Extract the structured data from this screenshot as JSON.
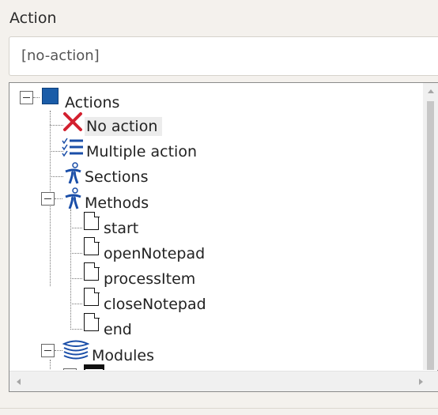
{
  "header": {
    "label": "Action",
    "field_value": "[no-action]"
  },
  "tree": {
    "root": "Actions",
    "items": {
      "no_action": "No action",
      "multiple_action": "Multiple action",
      "sections": "Sections",
      "methods": "Methods",
      "start": "start",
      "open_notepad": "openNotepad",
      "process_item": "processItem",
      "close_notepad": "closeNotepad",
      "end": "end",
      "modules": "Modules"
    }
  },
  "icons": {
    "root": "square-icon",
    "no_action": "red-x-icon",
    "multiple_action": "checklist-icon",
    "sections": "section-figure-icon",
    "methods": "section-figure-icon",
    "method_item": "page-icon",
    "modules": "stack-icon",
    "partial": "window-icon"
  },
  "colors": {
    "background": "#f4f1ed",
    "accent_blue": "#1a4ea8",
    "red_x": "#d3202f",
    "selected_row": "#ececec"
  }
}
